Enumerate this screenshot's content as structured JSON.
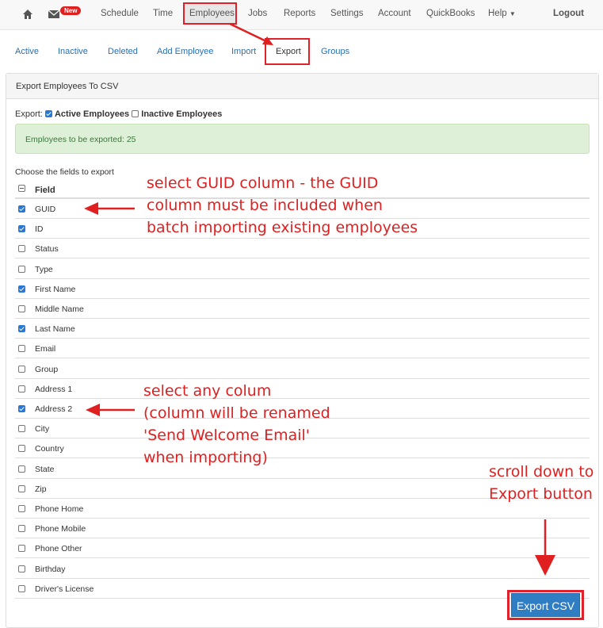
{
  "topnav": {
    "new_badge": "New",
    "items": [
      "Schedule",
      "Time",
      "Employees",
      "Jobs",
      "Reports",
      "Settings",
      "Account",
      "QuickBooks"
    ],
    "help": "Help",
    "logout": "Logout"
  },
  "subnav": [
    "Active",
    "Inactive",
    "Deleted",
    "Add Employee",
    "Import",
    "Export",
    "Groups"
  ],
  "panel": {
    "title": "Export Employees To CSV",
    "export_label": "Export:",
    "active_label": "Active Employees",
    "inactive_label": "Inactive Employees",
    "active_checked": true,
    "inactive_checked": false,
    "alert": "Employees to be exported: 25",
    "choose": "Choose the fields to export",
    "field_header": "Field"
  },
  "fields": [
    {
      "label": "GUID",
      "checked": true
    },
    {
      "label": "ID",
      "checked": true
    },
    {
      "label": "Status",
      "checked": false
    },
    {
      "label": "Type",
      "checked": false
    },
    {
      "label": "First Name",
      "checked": true
    },
    {
      "label": "Middle Name",
      "checked": false
    },
    {
      "label": "Last Name",
      "checked": true
    },
    {
      "label": "Email",
      "checked": false
    },
    {
      "label": "Group",
      "checked": false
    },
    {
      "label": "Address 1",
      "checked": false
    },
    {
      "label": "Address 2",
      "checked": true
    },
    {
      "label": "City",
      "checked": false
    },
    {
      "label": "Country",
      "checked": false
    },
    {
      "label": "State",
      "checked": false
    },
    {
      "label": "Zip",
      "checked": false
    },
    {
      "label": "Phone Home",
      "checked": false
    },
    {
      "label": "Phone Mobile",
      "checked": false
    },
    {
      "label": "Phone Other",
      "checked": false
    },
    {
      "label": "Birthday",
      "checked": false
    },
    {
      "label": "Driver's License",
      "checked": false
    }
  ],
  "annotations": {
    "guid": [
      "select GUID column - the GUID",
      "column must be included when",
      "batch importing existing employees"
    ],
    "address": [
      "select any colum",
      "(column will be renamed",
      "'Send Welcome Email'",
      "when importing)"
    ],
    "scroll": [
      "scroll down to",
      "Export button"
    ]
  },
  "export_button": "Export CSV",
  "colors": {
    "accent": "#2a6fb0",
    "annotation": "#e02020",
    "button": "#2f7ec4"
  }
}
